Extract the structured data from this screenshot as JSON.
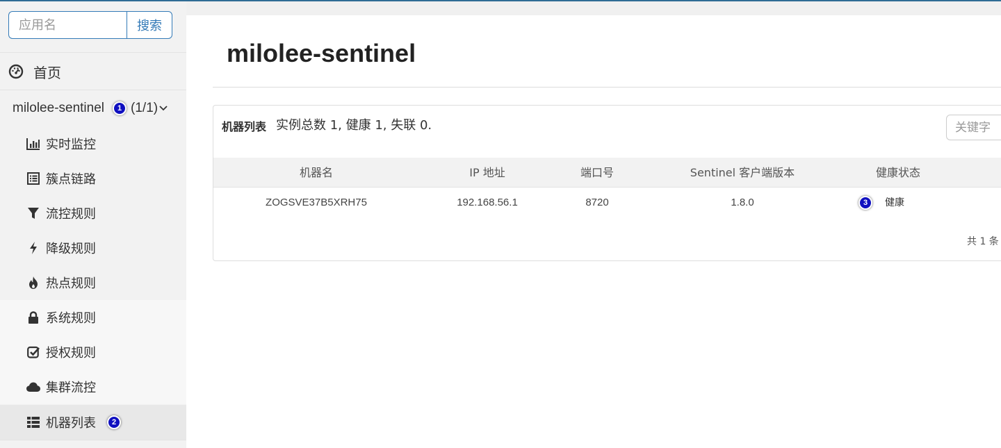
{
  "sidebar": {
    "search": {
      "placeholder": "应用名",
      "button_label": "搜索"
    },
    "home": {
      "label": "首页",
      "icon": "dashboard-icon"
    },
    "app": {
      "name": "milolee-sentinel",
      "badge": "1",
      "count": "(1/1)"
    },
    "menu": [
      {
        "label": "实时监控",
        "icon": "bar-chart-icon"
      },
      {
        "label": "簇点链路",
        "icon": "list-alt-icon"
      },
      {
        "label": "流控规则",
        "icon": "filter-icon"
      },
      {
        "label": "降级规则",
        "icon": "bolt-icon"
      },
      {
        "label": "热点规则",
        "icon": "fire-icon"
      },
      {
        "label": "系统规则",
        "icon": "lock-icon"
      },
      {
        "label": "授权规则",
        "icon": "check-square-icon"
      },
      {
        "label": "集群流控",
        "icon": "cloud-icon"
      },
      {
        "label": "机器列表",
        "icon": "th-list-icon",
        "badge": "2",
        "active": true
      }
    ]
  },
  "main": {
    "title": "milolee-sentinel",
    "panel": {
      "title": "机器列表",
      "summary": "实例总数 1, 健康 1, 失联 0.",
      "keyword_placeholder": "关键字",
      "columns": [
        "机器名",
        "IP 地址",
        "端口号",
        "Sentinel 客户端版本",
        "健康状态"
      ],
      "rows": [
        {
          "machine": "ZOGSVE37B5XRH75",
          "ip": "192.168.56.1",
          "port": "8720",
          "version": "1.8.0",
          "status": "健康",
          "badge": "3"
        }
      ],
      "pager_text": "共 1 条"
    }
  },
  "colors": {
    "accent": "#337ab7",
    "badge": "#1010c0",
    "topline": "#2f6c95"
  }
}
